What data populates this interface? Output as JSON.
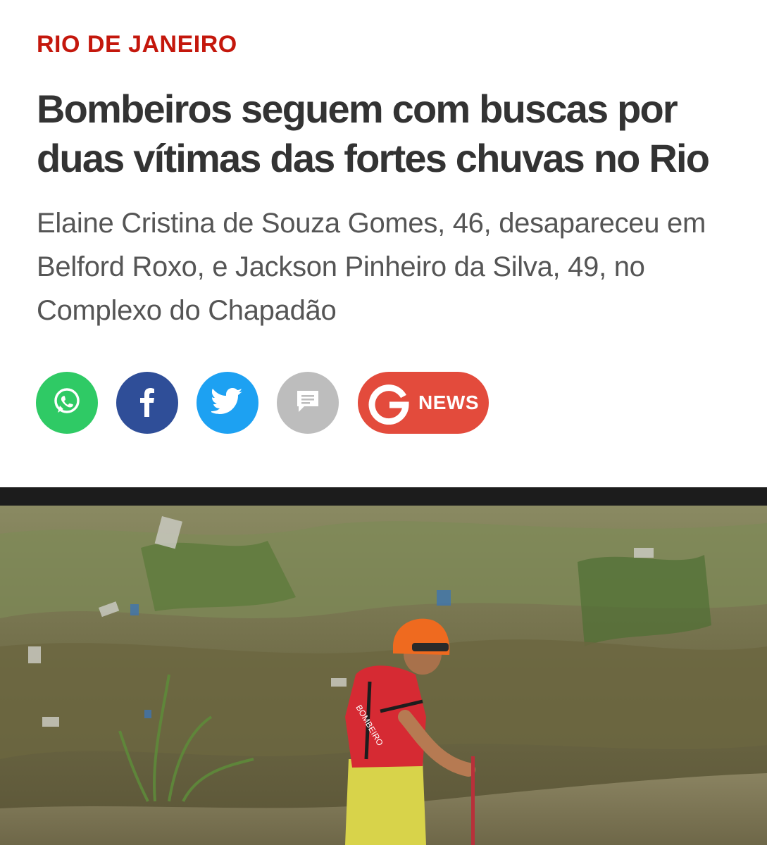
{
  "article": {
    "section": "RIO DE JANEIRO",
    "headline": "Bombeiros seguem com buscas por duas vítimas das fortes chuvas no Rio",
    "subtitle": "Elaine Cristina de Souza Gomes, 46, desapareceu em Belford Roxo, e Jackson Pinheiro da Silva, 49, no Complexo do Chapadão"
  },
  "share": {
    "buttons": [
      {
        "name": "whatsapp",
        "icon": "whatsapp-icon",
        "color": "#2fca65"
      },
      {
        "name": "facebook",
        "icon": "facebook-icon",
        "color": "#2f4e98"
      },
      {
        "name": "twitter",
        "icon": "twitter-icon",
        "color": "#1da1f2"
      },
      {
        "name": "comments",
        "icon": "comment-icon",
        "color": "#bdbdbd"
      }
    ],
    "gnews": {
      "icon": "google-g-icon",
      "label": "NEWS",
      "color": "#e34b3c"
    }
  },
  "photo": {
    "shirt_text": "BOMBEIRO"
  },
  "colors": {
    "section_red": "#c4170c",
    "headline": "#333333",
    "subtitle": "#555555"
  }
}
